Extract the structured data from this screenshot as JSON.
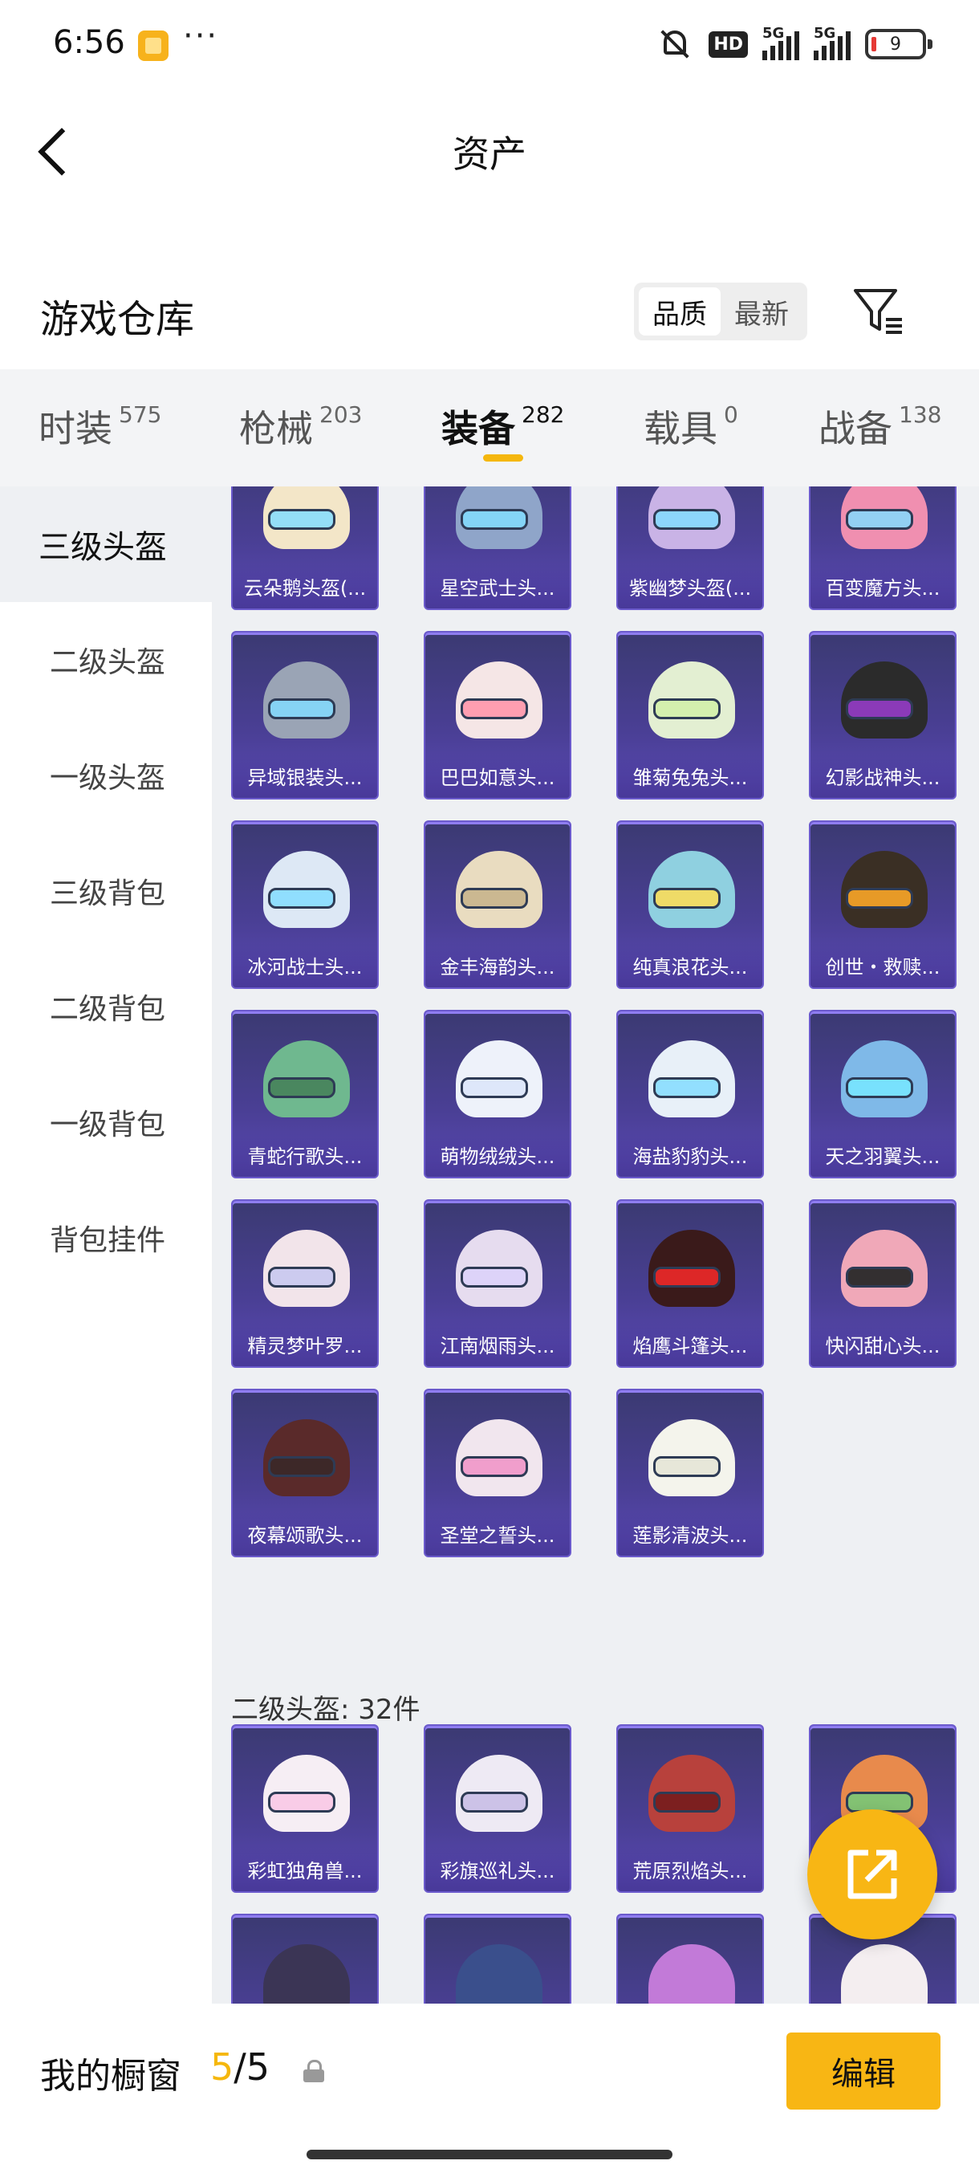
{
  "status_bar": {
    "time": "6:56",
    "more": "···",
    "hd": "HD",
    "net1": "5G",
    "net2": "5G",
    "battery": "9"
  },
  "header": {
    "title": "资产"
  },
  "warehouse": {
    "title": "游戏仓库",
    "sort_options": [
      "品质",
      "最新"
    ],
    "active_sort": 0
  },
  "tabs": [
    {
      "label": "时装",
      "count": "575"
    },
    {
      "label": "枪械",
      "count": "203"
    },
    {
      "label": "装备",
      "count": "282"
    },
    {
      "label": "载具",
      "count": "0"
    },
    {
      "label": "战备",
      "count": "138"
    }
  ],
  "active_tab": 2,
  "sidebar": {
    "items": [
      "三级头盔",
      "二级头盔",
      "一级头盔",
      "三级背包",
      "二级背包",
      "一级背包",
      "背包挂件"
    ],
    "active": 0
  },
  "items": {
    "row0": [
      "云朵鹅头盔(...",
      "星空武士头...",
      "紫幽梦头盔(...",
      "百变魔方头..."
    ],
    "row1": [
      "异域银装头...",
      "巴巴如意头...",
      "雏菊兔兔头...",
      "幻影战神头..."
    ],
    "row2": [
      "冰河战士头...",
      "金丰海韵头...",
      "纯真浪花头...",
      "创世・救赎..."
    ],
    "row3": [
      "青蛇行歌头...",
      "萌物绒绒头...",
      "海盐豹豹头...",
      "天之羽翼头..."
    ],
    "row4": [
      "精灵梦叶罗...",
      "江南烟雨头...",
      "焰鹰斗篷头...",
      "快闪甜心头..."
    ],
    "row5": [
      "夜幕颂歌头...",
      "圣堂之誓头...",
      "莲影清波头..."
    ],
    "section_label": "二级头盔: 32件",
    "row6": [
      "彩虹独角兽...",
      "彩旗巡礼头...",
      "荒原烈焰头...",
      ""
    ]
  },
  "bottom": {
    "showcase_label": "我的橱窗",
    "count_current": "5",
    "count_total": "/5",
    "edit_label": "编辑"
  },
  "colors": {
    "accent": "#f8b614",
    "card_purple": "#4a3f95"
  }
}
